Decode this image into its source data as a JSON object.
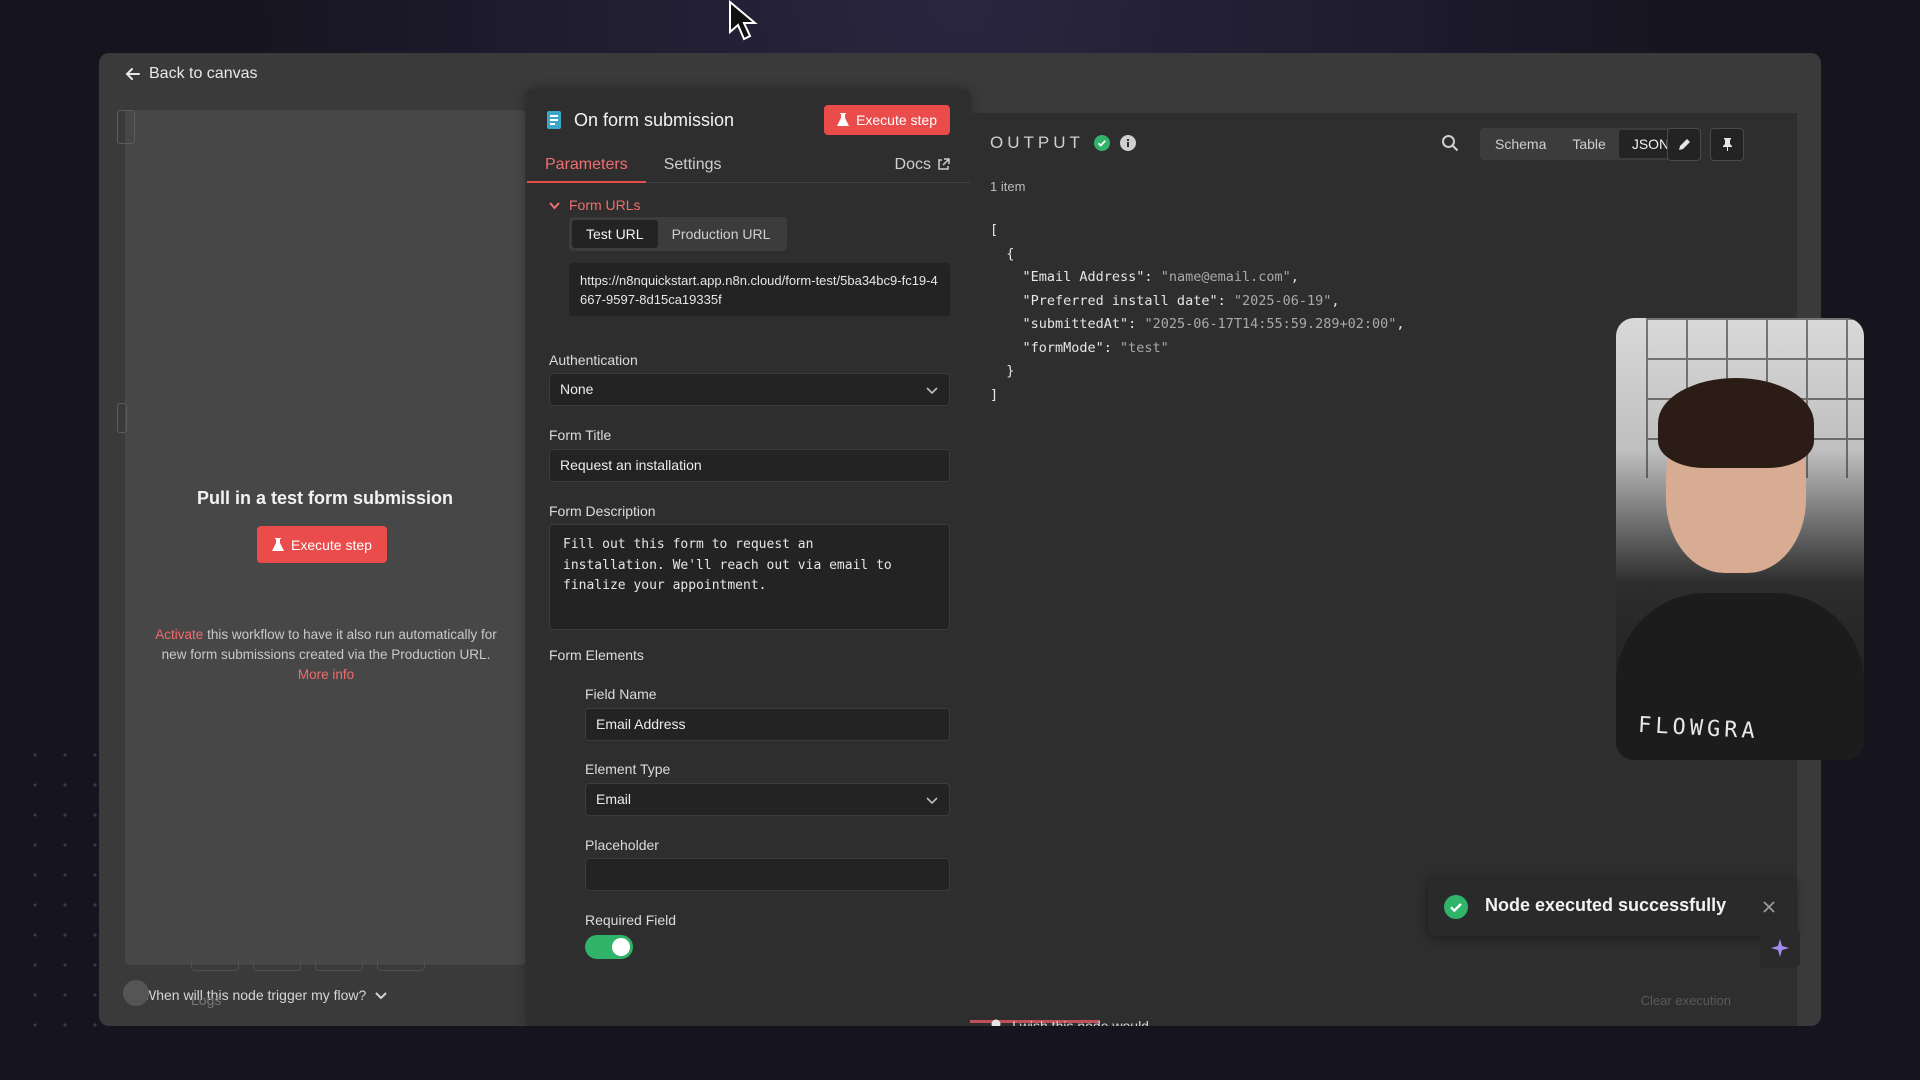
{
  "nav": {
    "back_label": "Back to canvas"
  },
  "input_pane": {
    "title": "Pull in a test form submission",
    "execute_label": "Execute step",
    "activate_link": "Activate",
    "activate_text": " this workflow to have it also run automatically for new form submissions created via the Production URL. ",
    "more_info": "More info",
    "trigger_question": "When will this node trigger my flow?"
  },
  "node": {
    "title": "On form submission",
    "execute_label": "Execute step",
    "tabs": [
      "Parameters",
      "Settings"
    ],
    "docs_label": "Docs",
    "section_label": "Form URLs",
    "url_tabs": [
      "Test URL",
      "Production URL"
    ],
    "url": "https://n8nquickstart.app.n8n.cloud/form-test/5ba34bc9-fc19-4667-9597-8d15ca19335f",
    "authentication": {
      "label": "Authentication",
      "value": "None"
    },
    "form_title": {
      "label": "Form Title",
      "value": "Request an installation"
    },
    "form_description": {
      "label": "Form Description",
      "value": "Fill out this form to request an\ninstallation. We'll reach out via email to\nfinalize your appointment."
    },
    "form_elements": {
      "label": "Form Elements",
      "field_name": {
        "label": "Field Name",
        "value": "Email Address"
      },
      "element_type": {
        "label": "Element Type",
        "value": "Email"
      },
      "placeholder": {
        "label": "Placeholder",
        "value": ""
      },
      "required": {
        "label": "Required Field",
        "on": true
      }
    }
  },
  "output": {
    "title": "OUTPUT",
    "items_count": "1 item",
    "views": [
      "Schema",
      "Table",
      "JSON"
    ],
    "active_view": "JSON",
    "json_lines": [
      "[",
      "  {",
      "    \"Email Address\": \"name@email.com\",",
      "    \"Preferred install date\": \"2025-06-19\",",
      "    \"submittedAt\": \"2025-06-17T14:55:59.289+02:00\",",
      "    \"formMode\": \"test\"",
      "  }",
      "]"
    ],
    "wish_label": "I wish this node would..."
  },
  "toast": {
    "message": "Node executed successfully"
  },
  "footer": {
    "logs_label": "Logs",
    "clear_label": "Clear execution"
  },
  "webcam": {
    "shirt_text": "FLOWGRA"
  },
  "colors": {
    "accent": "#ea4b4b",
    "success": "#2fb46a",
    "panel": "#2e2e2e"
  },
  "icons": [
    "arrow-left-icon",
    "flask-icon",
    "form-node-icon",
    "external-link-icon",
    "chevron-down-icon",
    "check-circle-icon",
    "info-icon",
    "search-icon",
    "pencil-icon",
    "pin-icon",
    "lightbulb-icon",
    "close-icon",
    "sparkle-icon",
    "cursor-icon"
  ]
}
